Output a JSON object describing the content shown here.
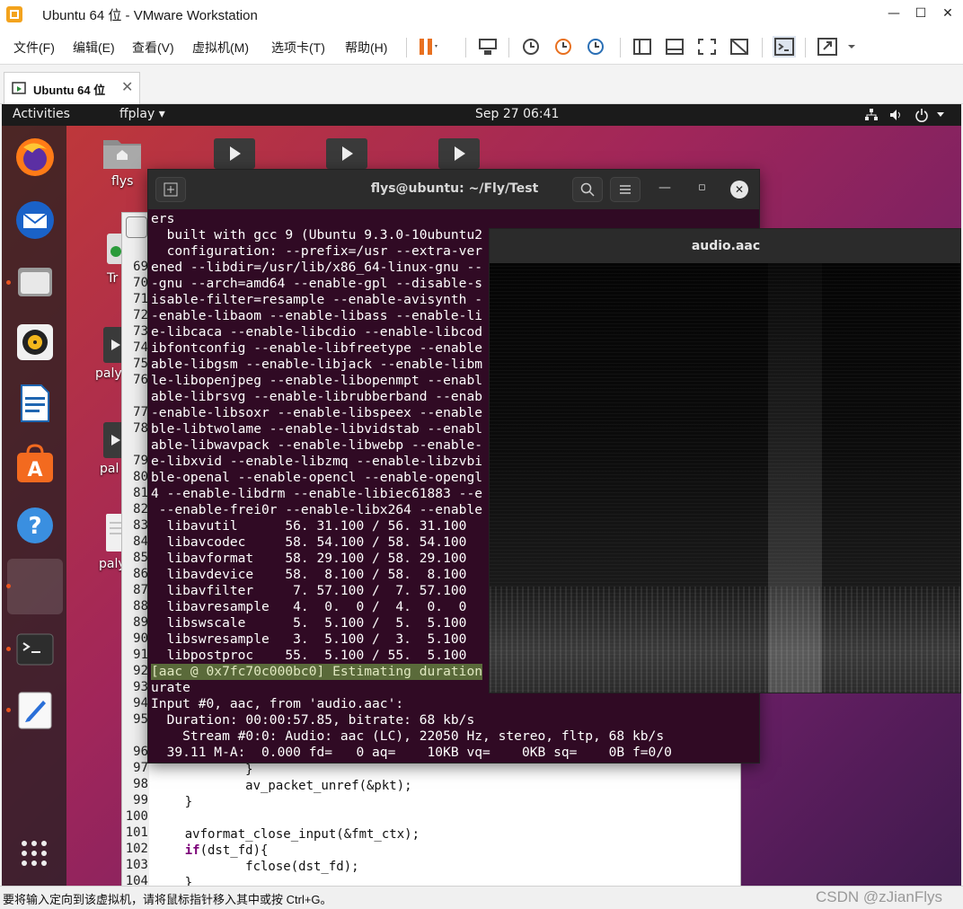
{
  "window": {
    "title": "Ubuntu 64 位 - VMware Workstation"
  },
  "menu": {
    "items": [
      "文件(F)",
      "编辑(E)",
      "查看(V)",
      "虚拟机(M)",
      "选项卡(T)",
      "帮助(H)"
    ]
  },
  "tab": {
    "label": "Ubuntu 64 位"
  },
  "gnome": {
    "activities": "Activities",
    "app": "ffplay ▾",
    "clock": "Sep 27  06:41"
  },
  "desktop": {
    "home_label": "flys",
    "trash_label": "Tr",
    "file_labels": [
      "paly",
      "pal",
      "paly"
    ]
  },
  "terminal": {
    "title": "flys@ubuntu: ~/Fly/Test",
    "lines": [
      "ers",
      "  built with gcc 9 (Ubuntu 9.3.0-10ubuntu2",
      "  configuration: --prefix=/usr --extra-ver",
      "ened --libdir=/usr/lib/x86_64-linux-gnu --",
      "-gnu --arch=amd64 --enable-gpl --disable-s",
      "isable-filter=resample --enable-avisynth -",
      "-enable-libaom --enable-libass --enable-li",
      "e-libcaca --enable-libcdio --enable-libcod",
      "ibfontconfig --enable-libfreetype --enable",
      "able-libgsm --enable-libjack --enable-libm",
      "le-libopenjpeg --enable-libopenmpt --enabl",
      "able-librsvg --enable-librubberband --enab",
      "-enable-libsoxr --enable-libspeex --enable",
      "ble-libtwolame --enable-libvidstab --enabl",
      "able-libwavpack --enable-libwebp --enable-",
      "e-libxvid --enable-libzmq --enable-libzvbi",
      "ble-openal --enable-opencl --enable-opengl",
      "4 --enable-libdrm --enable-libiec61883 --e",
      " --enable-frei0r --enable-libx264 --enable",
      "  libavutil      56. 31.100 / 56. 31.100",
      "  libavcodec     58. 54.100 / 58. 54.100",
      "  libavformat    58. 29.100 / 58. 29.100",
      "  libavdevice    58.  8.100 / 58.  8.100",
      "  libavfilter     7. 57.100 /  7. 57.100",
      "  libavresample   4.  0.  0 /  4.  0.  0",
      "  libswscale      5.  5.100 /  5.  5.100",
      "  libswresample   3.  5.100 /  3.  5.100",
      "  libpostproc    55.  5.100 / 55.  5.100",
      "[aac @ 0x7fc70c000bc0] Estimating duration",
      "urate",
      "Input #0, aac, from 'audio.aac':",
      "  Duration: 00:00:57.85, bitrate: 68 kb/s",
      "    Stream #0:0: Audio: aac (LC), 22050 Hz, stereo, fltp, 68 kb/s",
      "  39.11 M-A:  0.000 fd=   0 aq=    10KB vq=    0KB sq=    0B f=0/0"
    ]
  },
  "editor": {
    "gutter_lines": [
      "69",
      "70",
      "71",
      "72",
      "73",
      "74",
      "75",
      "76",
      "",
      "77",
      "78",
      "",
      "79",
      "80",
      "81",
      "82",
      "83",
      "84",
      "85",
      "86",
      "87",
      "88",
      "89",
      "90",
      "91",
      "92",
      "93",
      "94",
      "95",
      "",
      "96",
      "97",
      "98",
      "99",
      "100",
      "101",
      "102",
      "103",
      "104"
    ],
    "code_lines": [
      {
        "ln": "97",
        "text": "            }"
      },
      {
        "ln": "98",
        "text": "            av_packet_unref(&pkt);"
      },
      {
        "ln": "99",
        "text": "    }"
      },
      {
        "ln": "100",
        "text": ""
      },
      {
        "ln": "101",
        "text": "    avformat_close_input(&fmt_ctx);"
      },
      {
        "ln": "102",
        "kw": "if",
        "text": "(dst_fd){"
      },
      {
        "ln": "103",
        "text": "            fclose(dst_fd);"
      },
      {
        "ln": "104",
        "text": "    }"
      }
    ]
  },
  "audio": {
    "title": "audio.aac"
  },
  "status": {
    "message": "要将输入定向到该虚拟机，请将鼠标指针移入其中或按 Ctrl+G。",
    "watermark": "CSDN @zJianFlys"
  }
}
